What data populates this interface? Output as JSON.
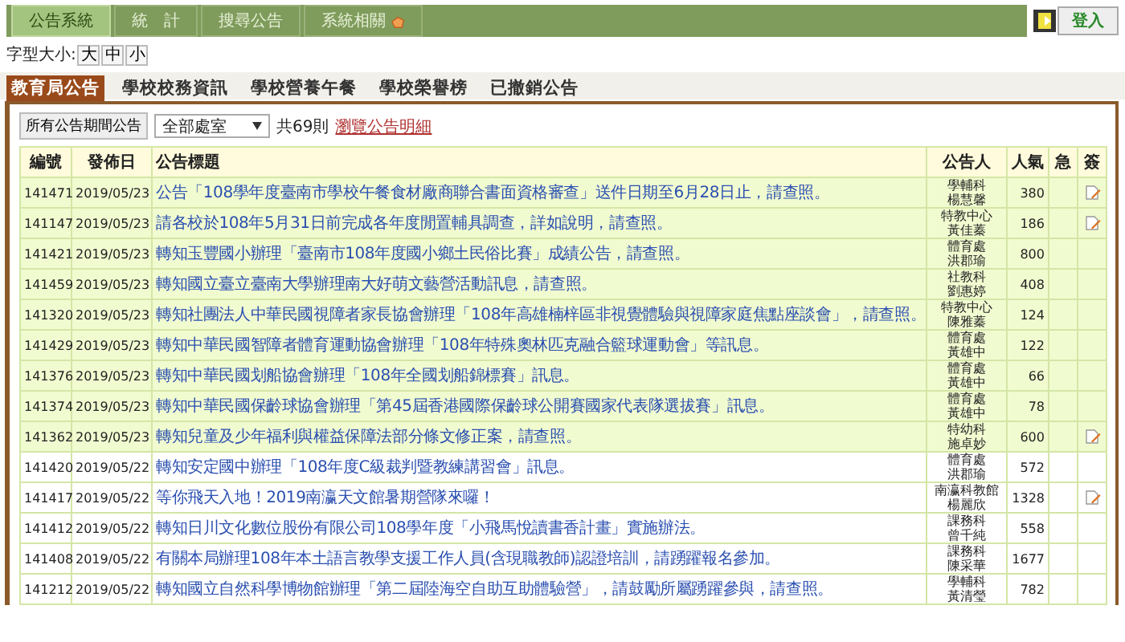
{
  "nav": {
    "tabs": [
      {
        "label": "公告系統",
        "selected": true,
        "hand": false
      },
      {
        "label": "統　計",
        "selected": false,
        "hand": false
      },
      {
        "label": "搜尋公告",
        "selected": false,
        "hand": false
      },
      {
        "label": "系統相關",
        "selected": false,
        "hand": true
      }
    ],
    "login": "登入"
  },
  "font_size": {
    "label": "字型大小:",
    "options": [
      "大",
      "中",
      "小"
    ]
  },
  "subtabs": [
    {
      "label": "教育局公告",
      "selected": true
    },
    {
      "label": "學校校務資訊",
      "selected": false
    },
    {
      "label": "學校營養午餐",
      "selected": false
    },
    {
      "label": "學校榮譽榜",
      "selected": false
    },
    {
      "label": "已撤銷公告",
      "selected": false
    }
  ],
  "filter": {
    "button": "所有公告期間公告",
    "select": "全部處室",
    "count": "共69則",
    "link": "瀏覽公告明細"
  },
  "table": {
    "columns": [
      "編號",
      "發佈日",
      "公告標題",
      "公告人",
      "人氣",
      "急",
      "簽"
    ],
    "rows": [
      {
        "id": "141471",
        "date": "2019/05/23",
        "title": "公告「108學年度臺南市學校午餐食材廠商聯合書面資格審查」送件日期至6月28日止，請查照。",
        "publisher": [
          "學輔科",
          "楊慧馨"
        ],
        "views": "380",
        "highlighted": true,
        "attachment": true
      },
      {
        "id": "141147",
        "date": "2019/05/23",
        "title": "請各校於108年5月31日前完成各年度閒置輔具調查，詳如說明，請查照。",
        "publisher": [
          "特教中心",
          "黃佳蓁"
        ],
        "views": "186",
        "highlighted": true,
        "attachment": true
      },
      {
        "id": "141421",
        "date": "2019/05/23",
        "title": "轉知玉豐國小辦理「臺南市108年度國小鄉土民俗比賽」成績公告，請查照。",
        "publisher": [
          "體育處",
          "洪郡瑜"
        ],
        "views": "800",
        "highlighted": true,
        "attachment": false
      },
      {
        "id": "141459",
        "date": "2019/05/23",
        "title": "轉知國立臺立臺南大學辦理南大好萌文藝營活動訊息，請查照。",
        "publisher": [
          "社教科",
          "劉惠婷"
        ],
        "views": "408",
        "highlighted": true,
        "attachment": false
      },
      {
        "id": "141320",
        "date": "2019/05/23",
        "title": "轉知社團法人中華民國視障者家長協會辦理「108年高雄楠梓區非視覺體驗與視障家庭焦點座談會」，請查照。",
        "publisher": [
          "特教中心",
          "陳雅蓁"
        ],
        "views": "124",
        "highlighted": true,
        "attachment": false
      },
      {
        "id": "141429",
        "date": "2019/05/23",
        "title": "轉知中華民國智障者體育運動協會辦理「108年特殊奧林匹克融合籃球運動會」等訊息。",
        "publisher": [
          "體育處",
          "黃雄中"
        ],
        "views": "122",
        "highlighted": true,
        "attachment": false
      },
      {
        "id": "141376",
        "date": "2019/05/23",
        "title": "轉知中華民國划船協會辦理「108年全國划船錦標賽」訊息。",
        "publisher": [
          "體育處",
          "黃雄中"
        ],
        "views": "66",
        "highlighted": true,
        "attachment": false
      },
      {
        "id": "141374",
        "date": "2019/05/23",
        "title": "轉知中華民國保齡球協會辦理「第45屆香港國際保齡球公開賽國家代表隊選拔賽」訊息。",
        "publisher": [
          "體育處",
          "黃雄中"
        ],
        "views": "78",
        "highlighted": true,
        "attachment": false
      },
      {
        "id": "141362",
        "date": "2019/05/23",
        "title": "轉知兒童及少年福利與權益保障法部分條文修正案，請查照。",
        "publisher": [
          "特幼科",
          "施卓妙"
        ],
        "views": "600",
        "highlighted": true,
        "attachment": true
      },
      {
        "id": "141420",
        "date": "2019/05/22",
        "title": "轉知安定國中辦理「108年度C級裁判暨教練講習會」訊息。",
        "publisher": [
          "體育處",
          "洪郡瑜"
        ],
        "views": "572",
        "highlighted": false,
        "attachment": false
      },
      {
        "id": "141417",
        "date": "2019/05/22",
        "title": "等你飛天入地！2019南瀛天文館暑期營隊來囉！",
        "publisher": [
          "南瀛科教館",
          "楊麗欣"
        ],
        "views": "1328",
        "highlighted": false,
        "attachment": true
      },
      {
        "id": "141412",
        "date": "2019/05/22",
        "title": "轉知日川文化數位股份有限公司108學年度「小飛馬悅讀書香計畫」實施辦法。",
        "publisher": [
          "課務科",
          "曾千純"
        ],
        "views": "558",
        "highlighted": false,
        "attachment": false
      },
      {
        "id": "141408",
        "date": "2019/05/22",
        "title": "有關本局辦理108年本土語言教學支援工作人員(含現職教師)認證培訓，請踴躍報名參加。",
        "publisher": [
          "課務科",
          "陳采華"
        ],
        "views": "1677",
        "highlighted": false,
        "attachment": false
      },
      {
        "id": "141212",
        "date": "2019/05/22",
        "title": "轉知國立自然科學博物館辦理「第二屆陸海空自助互助體驗營」，請鼓勵所屬踴躍參與，請查照。",
        "publisher": [
          "學輔科",
          "黃清瑩"
        ],
        "views": "782",
        "highlighted": false,
        "attachment": false
      }
    ]
  }
}
